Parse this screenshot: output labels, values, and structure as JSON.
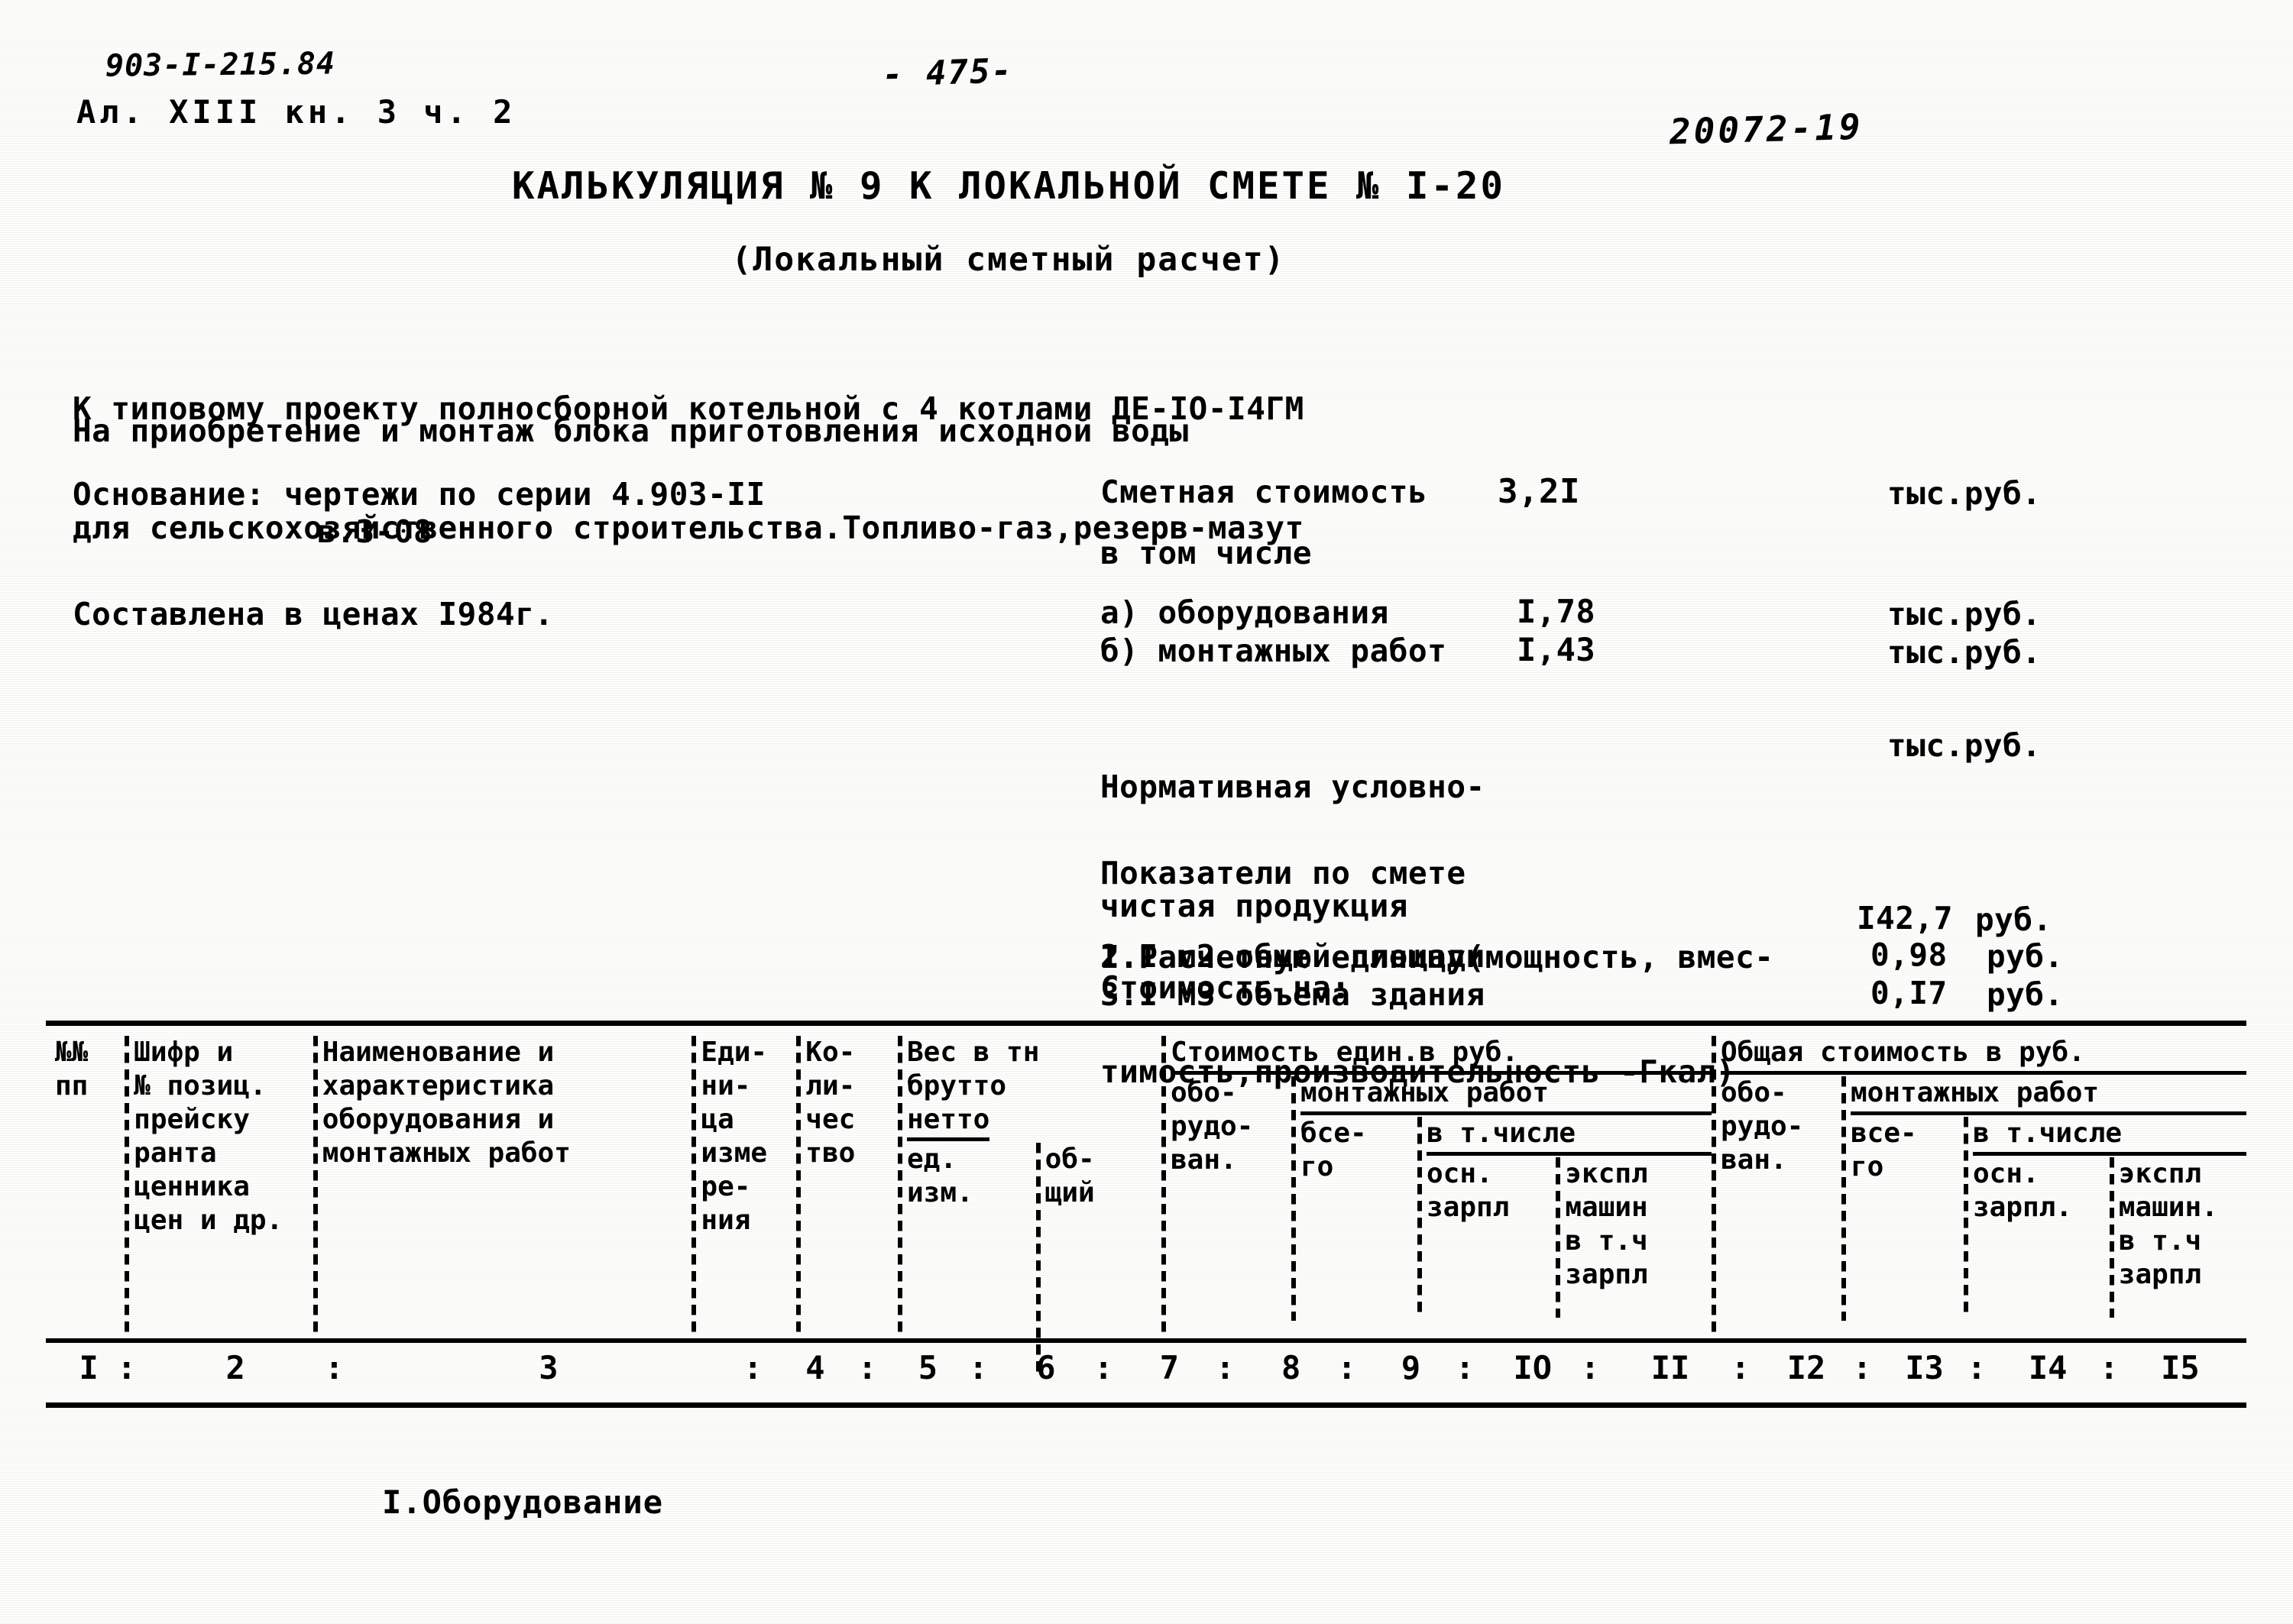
{
  "header": {
    "doc_code": "903-I-215.84",
    "album_line": "Ал. XIII кн. 3 ч. 2",
    "page_number": "- 475-",
    "archive_stamp": "20072-19"
  },
  "title": {
    "main": "КАЛЬКУЛЯЦИЯ № 9 К ЛОКАЛЬНОЙ СМЕТЕ № I-20",
    "subtitle": "(Локальный сметный расчет)"
  },
  "intro": {
    "line1": "К типовому проекту полносборной котельной с 4 котлами ДЕ-IO-I4ГМ",
    "line2": "для сельскохозяйственного строительства.Топливо-газ,резерв-мазут",
    "purpose": "На приобретение и монтаж блока приготовления исходной воды"
  },
  "basis": {
    "label": "Основание: чертежи по серии 4.903-II",
    "line2": "в.3-08",
    "prices": "Составлена в ценах I984г."
  },
  "summary": {
    "total_label": "Сметная стоимость",
    "total_value": "3,2I",
    "total_unit": "тыс.руб.",
    "including_label": "в том числе",
    "equipment_label": "а) оборудования",
    "equipment_value": "I,78",
    "equipment_unit": "тыс.руб.",
    "install_label": "б) монтажных работ",
    "install_value": "I,43",
    "install_unit": "тыс.руб.",
    "nchp_label_line1": "Нормативная условно-",
    "nchp_label_line2": "чистая продукция",
    "nchp_unit": "тыс.руб."
  },
  "indicators": {
    "header_line1": "Показатели по смете",
    "header_line2": "Стоимость на:",
    "item1_line1": "I.Расчетную единицу(мощность, вмес-",
    "item1_line2": "тимость,производительность -Гкал)",
    "item1_value": "I42,7",
    "item1_unit": "руб.",
    "item2_label": "2.I м2 общей площади",
    "item2_value": "0,98",
    "item2_unit": "руб.",
    "item3_label": "3.I м3 объема здания",
    "item3_value": "0,I7",
    "item3_unit": "руб."
  },
  "table": {
    "columns": {
      "num": [
        "№№",
        "пп"
      ],
      "cipher": [
        "Шифр и",
        "№ позиц.",
        "прейску",
        "ранта",
        "ценника",
        "цен и др."
      ],
      "name": [
        "Наименование и",
        "характеристика",
        "оборудования и",
        "монтажных работ"
      ],
      "unit": [
        "Еди-",
        "ни-",
        "ца",
        "изме",
        "ре-",
        "ния"
      ],
      "qty": [
        "Ко-",
        "ли-",
        "чес",
        "тво"
      ],
      "weight_group": "Вес в тн",
      "weight_gross": "брутто",
      "weight_net": "нетто",
      "weight_sub_unit": "ед.",
      "weight_sub_unit2": "изм.",
      "weight_sub_total": "об-",
      "weight_sub_total2": "щий",
      "unit_cost_group": "Стоимость един.в руб.",
      "total_cost_group": "Общая стоимость в руб.",
      "equip1": "обо-",
      "equip2": "рудо-",
      "equip3": "ван.",
      "install_group": "монтажных работ",
      "all1": "все-",
      "all2": "го",
      "bse1": "бсе-",
      "bse2": "го",
      "incl": "в т.числе",
      "osn": "осн.",
      "zarpl": "зарпл",
      "zarpl_dot": "зарпл.",
      "ekspl": "экспл",
      "mashin": "машин",
      "mashin_dot": "машин.",
      "vtch": "в т.ч",
      "vtch_colon": "в т.ч",
      "zarpl2": "зарпл"
    },
    "column_numbers": [
      "I",
      "2",
      "3",
      "4",
      "5",
      "6",
      "7",
      "8",
      "9",
      "IO",
      "II",
      "I2",
      "I3",
      "I4",
      "I5"
    ]
  },
  "section": {
    "label": "I.Оборудование"
  },
  "colors": {
    "ink": "#000000",
    "paper": "#fdfdfc"
  }
}
